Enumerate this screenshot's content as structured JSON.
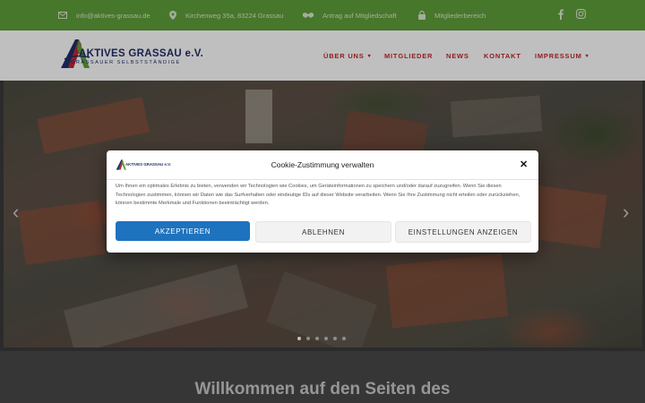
{
  "topbar": {
    "email": "info@aktives-grassau.de",
    "address": "Kirchenweg 35a, 83224 Grassau",
    "membership": "Antrag auf Mitgliedschaft",
    "members_area": "Mitgliederbereich",
    "icons": [
      "envelope-icon",
      "map-marker-icon",
      "handshake-icon",
      "lock-icon",
      "facebook-icon",
      "instagram-icon"
    ],
    "background_color": "#5f9f3a"
  },
  "logo": {
    "name": "AKTIVES GRASSAU e.V.",
    "tagline": "GRASSAUER SELBSTSTÄNDIGE"
  },
  "nav": {
    "items": [
      {
        "label": "ÜBER UNS",
        "dropdown": true
      },
      {
        "label": "MITGLIEDER",
        "dropdown": false
      },
      {
        "label": "NEWS",
        "dropdown": false
      },
      {
        "label": "KONTAKT",
        "dropdown": false
      },
      {
        "label": "IMPRESSUM",
        "dropdown": true
      }
    ],
    "color": "#c0272d"
  },
  "slider": {
    "slide_count": 6,
    "active_slide": 1
  },
  "welcome": {
    "heading": "Willkommen auf den Seiten des"
  },
  "cookie": {
    "title": "Cookie-Zustimmung verwalten",
    "text": "Um Ihnen ein optimales Erlebnis zu bieten, verwenden wir Technologien wie Cookies, um Geräteinformationen zu speichern und/oder darauf zuzugreifen. Wenn Sie diesen Technologien zustimmen, können wir Daten wie das Surfverhalten oder eindeutige IDs auf dieser Website verarbeiten. Wenn Sie Ihre Zustimmung nicht erteilen oder zurückziehen, können bestimmte Merkmale und Funktionen beeinträchtigt werden.",
    "accept": "AKZEPTIEREN",
    "reject": "ABLEHNEN",
    "settings": "EINSTELLUNGEN ANZEIGEN",
    "logo_text": "AKTIVES GRASSAU e.V.",
    "accent_color": "#1e73be"
  }
}
